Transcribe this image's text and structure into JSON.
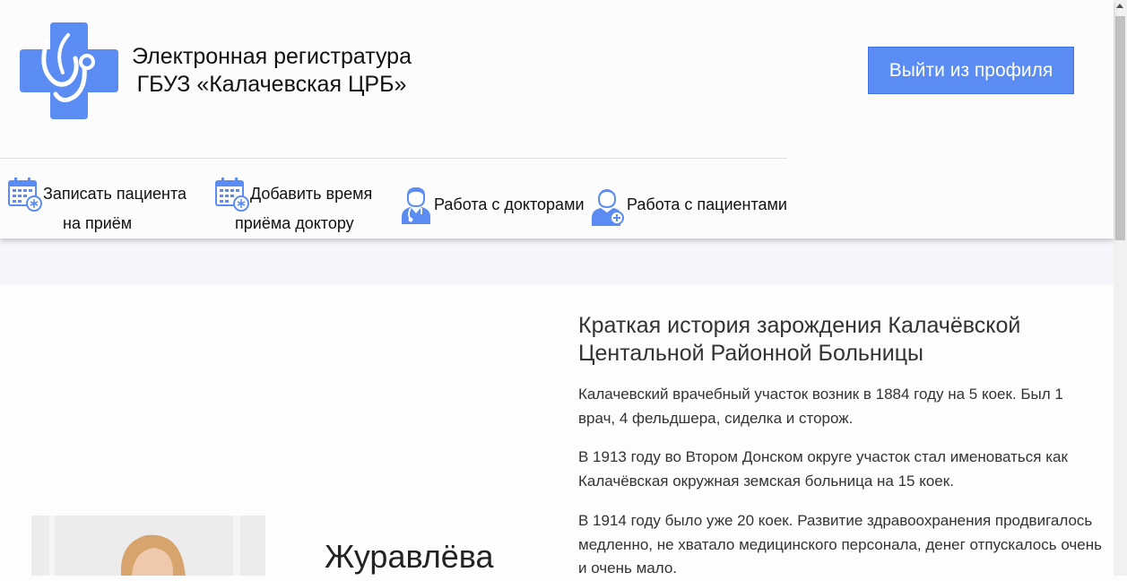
{
  "header": {
    "brand_line1": "Электронная регистратура",
    "brand_line2": "ГБУЗ «Калачевская ЦРБ»",
    "logout_label": "Выйти из профиля",
    "accent_color": "#5b8cf3",
    "logo_icon": "medical-cross-stethoscope-icon"
  },
  "nav": {
    "items": [
      {
        "line1": "Записать пациента",
        "line2": "на приём",
        "icon": "calendar-icon"
      },
      {
        "line1": "Добавить время",
        "line2": "приёма доктору",
        "icon": "calendar-icon"
      },
      {
        "line1": "Работа с докторами",
        "icon": "doctor-icon"
      },
      {
        "line1": "Работа с пациентами",
        "icon": "patient-icon"
      }
    ]
  },
  "main": {
    "history_title": "Краткая история зарождения Калачёвской Центальной Районной Больницы",
    "paragraphs": [
      "Калачевский врачебный участок возник в 1884 году на 5 коек. Был 1 врач, 4 фельдшера, сиделка и сторож.",
      "В 1913 году во Втором Донском округе участок стал именоваться как Калачёвская окружная земская больница на 15 коек.",
      "В 1914 году было уже 20 коек. Развитие здравоохранения продвигалось медленно, не хватало медицинского персонала, денег отпускалось очень и очень мало."
    ],
    "doctor_name": "Журавлёва"
  }
}
